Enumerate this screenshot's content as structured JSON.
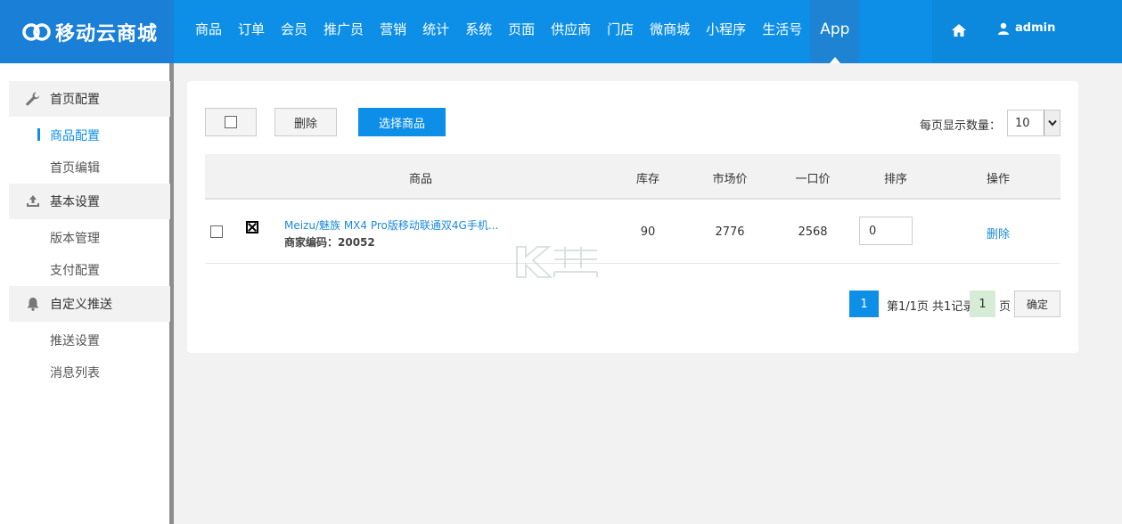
{
  "header": {
    "logo_text": "移动云商城",
    "nav": [
      "商品",
      "订单",
      "会员",
      "推广员",
      "营销",
      "统计",
      "系统",
      "页面",
      "供应商",
      "门店",
      "微商城",
      "小程序",
      "生活号",
      "App"
    ],
    "active_nav": "App",
    "user": "admin"
  },
  "sidebar": {
    "groups": [
      {
        "label": "首页配置",
        "icon": "wrench-icon",
        "items": [
          "商品配置",
          "首页编辑"
        ]
      },
      {
        "label": "基本设置",
        "icon": "upload-icon",
        "items": [
          "版本管理",
          "支付配置"
        ]
      },
      {
        "label": "自定义推送",
        "icon": "bell-icon",
        "items": [
          "推送设置",
          "消息列表"
        ]
      }
    ],
    "active_item": "商品配置"
  },
  "toolbar": {
    "delete_label": "删除",
    "select_label": "选择商品",
    "perpage_label": "每页显示数量：",
    "perpage_value": "10"
  },
  "table": {
    "headers": [
      "商品",
      "库存",
      "市场价",
      "一口价",
      "排序",
      "操作"
    ],
    "rows": [
      {
        "name": "Meizu/魅族 MX4 Pro版移动联通双4G手机...",
        "code": "商家编码：20052",
        "stock": "90",
        "market_price": "2776",
        "price": "2568",
        "sort": "0",
        "action": "删除"
      }
    ]
  },
  "pagination": {
    "current": "1",
    "info": "第1/1页 共1记录",
    "input": "1",
    "unit": "页",
    "confirm": "确定"
  },
  "colors": {
    "primary": "#0d8fe8",
    "link": "#1a8ad8",
    "logo_bg": "#1a7fd6"
  }
}
